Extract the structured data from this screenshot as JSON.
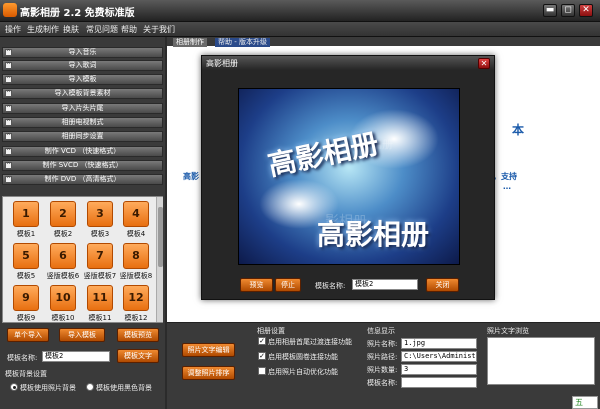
{
  "titlebar": {
    "title": "高影相册 2.2 免费标准版",
    "min": "▬",
    "max": "◻",
    "close": "✕"
  },
  "menubar": [
    "操作",
    "生成制作",
    "换肤",
    "常见问题",
    "帮助",
    "关于我们"
  ],
  "left": {
    "accordion": [
      "导入音乐",
      "导入歌词",
      "导入模板",
      "导入模板背景素材",
      "导入片头片尾",
      "相册电视制式",
      "相册同步设置",
      "制作 VCD （快速格式）",
      "制作 SVCD （快速格式）",
      "制作 DVD （高清格式）"
    ],
    "templates": [
      {
        "num": "1",
        "label": "模板1"
      },
      {
        "num": "2",
        "label": "模板2"
      },
      {
        "num": "3",
        "label": "模板3"
      },
      {
        "num": "4",
        "label": "模板4"
      },
      {
        "num": "5",
        "label": "模板5"
      },
      {
        "num": "6",
        "label": "竖版模板6"
      },
      {
        "num": "7",
        "label": "竖版模板7"
      },
      {
        "num": "8",
        "label": "竖版模板8"
      },
      {
        "num": "9",
        "label": "模板9"
      },
      {
        "num": "10",
        "label": "模板10"
      },
      {
        "num": "11",
        "label": "模板11"
      },
      {
        "num": "12",
        "label": "模板12"
      }
    ],
    "buttons": {
      "single_import": "单个导入",
      "import_template": "导入模板",
      "template_preview": "模板预览",
      "template_text": "模板文字"
    },
    "template_name_label": "模板名称:",
    "template_name_value": "模板2",
    "bg_settings_title": "模板背景设置",
    "radio_photo_bg": "模板使用照片背景",
    "radio_black_bg": "模板使用黑色背景"
  },
  "tabs": {
    "album": "相册制作",
    "help": "帮助 - 版本升级"
  },
  "main_bg": {
    "partial_right": "本",
    "partial_left": "高影",
    "partial_right2": "，支持",
    "partial_right3": "…"
  },
  "bottom": {
    "edit_photo_text": "照片文字编辑",
    "arrange_photos": "调整照片排序",
    "album_settings_title": "相册设置",
    "opt_transition": "启用相册首尾过渡连接功能",
    "opt_loop": "启用模板圆卷连接功能",
    "opt_auto_optimize": "启用照片自动优化功能",
    "info_title": "信息显示",
    "photo_name_label": "照片名称:",
    "photo_name_value": "1.jpg",
    "photo_path_label": "照片路径:",
    "photo_path_value": "C:\\Users\\Administra",
    "photo_count_label": "照片数量:",
    "photo_count_value": "3",
    "template_name_label": "模板名称:",
    "template_name_value": "",
    "photo_text_preview_title": "照片文字浏览"
  },
  "dialog": {
    "title": "高影相册",
    "image_text_big1": "高影相册",
    "image_text_big2": "高影相册",
    "image_ghost1": "高影相册",
    "image_ghost2": "影相册",
    "preview_btn": "预览",
    "stop_btn": "停止",
    "name_label": "模板名称:",
    "name_value": "模板2",
    "close_btn": "关闭"
  },
  "statusbar": {
    "icon_text": "五"
  },
  "colors": {
    "orange": "#e86f10",
    "dark_bg": "#3a3a3a",
    "accent_blue": "#1a5aaa"
  }
}
